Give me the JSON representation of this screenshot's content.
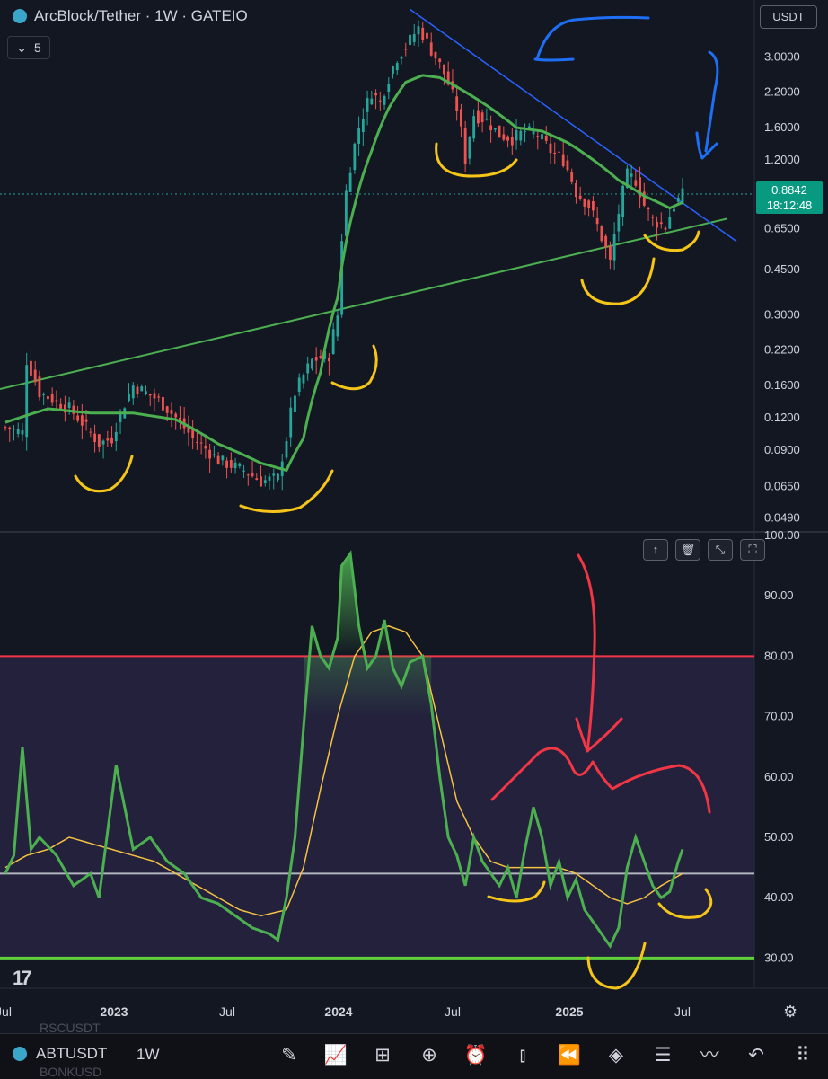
{
  "header": {
    "title": "ArcBlock/Tether · 1W · GATEIO",
    "currency": "USDT",
    "collapse_count": "5",
    "last_price": "0.8842",
    "countdown": "18:12:48"
  },
  "toolbar": {
    "symbol": "ABTUSDT",
    "timeframe": "1W",
    "ghost_top": "RSCUSDT",
    "ghost_bottom": "BONKUSD"
  },
  "colors": {
    "background": "#131722",
    "up": "#26a69a",
    "down": "#ef5350",
    "ma": "#4caf50",
    "rsi": "#4caf50",
    "rsi_ma": "#f5c242",
    "band": "#2a2545",
    "upper_line": "#f23645",
    "mid_line": "#b2b5be",
    "lower_line": "#5fd03a",
    "trend_support": "#4caf50",
    "trend_resistance": "#2962ff",
    "annot_yellow": "#f5c518",
    "annot_blue": "#1e6ff5",
    "annot_red": "#f23645"
  },
  "chart_data": {
    "type": "candlestick",
    "scale": "log",
    "price_ticks": [
      "3.0000",
      "2.2000",
      "1.6000",
      "1.2000",
      "0.6500",
      "0.4500",
      "0.3000",
      "0.2200",
      "0.1600",
      "0.1200",
      "0.0900",
      "0.0650",
      "0.0490"
    ],
    "price_ylim": [
      0.044,
      5.0
    ],
    "time_labels": [
      "Jul",
      "2023",
      "Jul",
      "2024",
      "Jul",
      "2025",
      "Jul"
    ],
    "candle_count": 160,
    "close_anchors": [
      [
        0,
        0.11
      ],
      [
        4,
        0.105
      ],
      [
        5,
        0.2
      ],
      [
        8,
        0.15
      ],
      [
        15,
        0.13
      ],
      [
        22,
        0.095
      ],
      [
        25,
        0.1
      ],
      [
        30,
        0.16
      ],
      [
        36,
        0.14
      ],
      [
        44,
        0.1
      ],
      [
        50,
        0.082
      ],
      [
        56,
        0.075
      ],
      [
        60,
        0.068
      ],
      [
        64,
        0.07
      ],
      [
        66,
        0.1
      ],
      [
        68,
        0.15
      ],
      [
        72,
        0.2
      ],
      [
        76,
        0.21
      ],
      [
        78,
        0.3
      ],
      [
        80,
        0.9
      ],
      [
        83,
        1.6
      ],
      [
        86,
        2.2
      ],
      [
        88,
        2.0
      ],
      [
        90,
        2.5
      ],
      [
        92,
        3.0
      ],
      [
        94,
        3.3
      ],
      [
        97,
        3.9
      ],
      [
        100,
        3.2
      ],
      [
        103,
        2.6
      ],
      [
        106,
        1.9
      ],
      [
        108,
        1.2
      ],
      [
        110,
        1.8
      ],
      [
        113,
        1.7
      ],
      [
        116,
        1.5
      ],
      [
        119,
        1.45
      ],
      [
        122,
        1.55
      ],
      [
        125,
        1.5
      ],
      [
        128,
        1.3
      ],
      [
        131,
        1.2
      ],
      [
        134,
        0.9
      ],
      [
        137,
        0.8
      ],
      [
        140,
        0.6
      ],
      [
        142,
        0.48
      ],
      [
        144,
        0.75
      ],
      [
        146,
        1.05
      ],
      [
        148,
        1.0
      ],
      [
        150,
        0.8
      ],
      [
        152,
        0.7
      ],
      [
        155,
        0.66
      ],
      [
        157,
        0.8
      ],
      [
        159,
        0.88
      ]
    ],
    "ma_anchors": [
      [
        0,
        0.115
      ],
      [
        10,
        0.13
      ],
      [
        20,
        0.125
      ],
      [
        30,
        0.125
      ],
      [
        40,
        0.118
      ],
      [
        50,
        0.095
      ],
      [
        60,
        0.08
      ],
      [
        66,
        0.075
      ],
      [
        70,
        0.1
      ],
      [
        74,
        0.18
      ],
      [
        78,
        0.35
      ],
      [
        82,
        0.8
      ],
      [
        86,
        1.3
      ],
      [
        90,
        1.9
      ],
      [
        94,
        2.4
      ],
      [
        98,
        2.55
      ],
      [
        102,
        2.5
      ],
      [
        108,
        2.2
      ],
      [
        114,
        1.9
      ],
      [
        120,
        1.6
      ],
      [
        126,
        1.55
      ],
      [
        132,
        1.4
      ],
      [
        138,
        1.2
      ],
      [
        144,
        1.0
      ],
      [
        150,
        0.87
      ],
      [
        156,
        0.78
      ],
      [
        159,
        0.82
      ]
    ],
    "rsi": {
      "ylim": [
        25,
        100
      ],
      "ticks": [
        "100.00",
        "90.00",
        "80.00",
        "70.00",
        "60.00",
        "50.00",
        "40.00",
        "30.00"
      ],
      "upper": 80,
      "middle": 44,
      "lower": 30,
      "values": [
        [
          0,
          44
        ],
        [
          2,
          47
        ],
        [
          4,
          65
        ],
        [
          6,
          48
        ],
        [
          8,
          50
        ],
        [
          12,
          47
        ],
        [
          16,
          42
        ],
        [
          20,
          44
        ],
        [
          22,
          40
        ],
        [
          26,
          62
        ],
        [
          30,
          48
        ],
        [
          34,
          50
        ],
        [
          38,
          46
        ],
        [
          42,
          44
        ],
        [
          46,
          40
        ],
        [
          50,
          39
        ],
        [
          54,
          37
        ],
        [
          58,
          35
        ],
        [
          62,
          34
        ],
        [
          64,
          33
        ],
        [
          66,
          40
        ],
        [
          68,
          50
        ],
        [
          70,
          68
        ],
        [
          72,
          85
        ],
        [
          74,
          80
        ],
        [
          76,
          78
        ],
        [
          78,
          83
        ],
        [
          79,
          95
        ],
        [
          81,
          97
        ],
        [
          83,
          85
        ],
        [
          85,
          78
        ],
        [
          87,
          80
        ],
        [
          89,
          86
        ],
        [
          91,
          78
        ],
        [
          93,
          75
        ],
        [
          95,
          79
        ],
        [
          98,
          80
        ],
        [
          100,
          72
        ],
        [
          102,
          60
        ],
        [
          104,
          50
        ],
        [
          106,
          47
        ],
        [
          108,
          42
        ],
        [
          110,
          50
        ],
        [
          112,
          46
        ],
        [
          114,
          44
        ],
        [
          116,
          42
        ],
        [
          118,
          45
        ],
        [
          120,
          40
        ],
        [
          122,
          48
        ],
        [
          124,
          55
        ],
        [
          126,
          50
        ],
        [
          128,
          42
        ],
        [
          130,
          46
        ],
        [
          132,
          40
        ],
        [
          134,
          43
        ],
        [
          136,
          38
        ],
        [
          138,
          36
        ],
        [
          140,
          34
        ],
        [
          142,
          32
        ],
        [
          144,
          35
        ],
        [
          146,
          45
        ],
        [
          148,
          50
        ],
        [
          150,
          46
        ],
        [
          152,
          42
        ],
        [
          154,
          40
        ],
        [
          156,
          41
        ],
        [
          158,
          46
        ],
        [
          159,
          48
        ]
      ],
      "ma": [
        [
          0,
          45
        ],
        [
          5,
          47
        ],
        [
          10,
          48
        ],
        [
          15,
          50
        ],
        [
          20,
          49
        ],
        [
          25,
          48
        ],
        [
          30,
          47
        ],
        [
          35,
          46
        ],
        [
          40,
          44
        ],
        [
          45,
          42
        ],
        [
          50,
          40
        ],
        [
          55,
          38
        ],
        [
          60,
          37
        ],
        [
          66,
          38
        ],
        [
          70,
          45
        ],
        [
          74,
          58
        ],
        [
          78,
          70
        ],
        [
          82,
          80
        ],
        [
          86,
          84
        ],
        [
          90,
          85
        ],
        [
          94,
          84
        ],
        [
          98,
          80
        ],
        [
          102,
          68
        ],
        [
          106,
          56
        ],
        [
          110,
          50
        ],
        [
          114,
          46
        ],
        [
          118,
          45
        ],
        [
          122,
          45
        ],
        [
          126,
          45
        ],
        [
          130,
          45
        ],
        [
          134,
          44
        ],
        [
          138,
          42
        ],
        [
          142,
          40
        ],
        [
          146,
          39
        ],
        [
          150,
          40
        ],
        [
          154,
          42
        ],
        [
          159,
          44
        ]
      ]
    }
  }
}
